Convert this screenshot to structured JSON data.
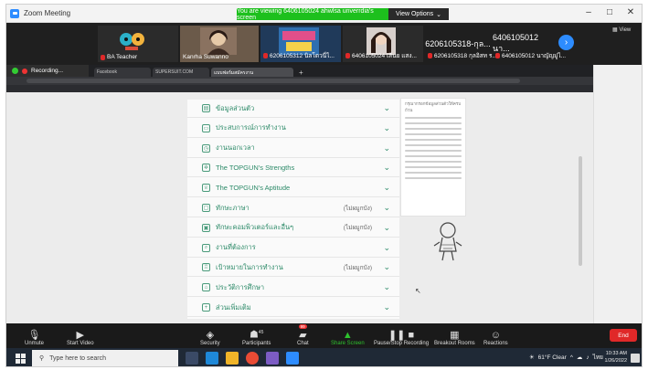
{
  "zoom": {
    "title": "Zoom Meeting",
    "viewing_banner": "You are viewing 6406105024 ahwlsa unverrdia's screen",
    "view_options": "View Options",
    "view_options_caret": "⌄",
    "win_min": "–",
    "win_max": "□",
    "win_close": "✕",
    "view_label": "View"
  },
  "participants_strip": [
    {
      "name": "BA Teacher"
    },
    {
      "name": "Kanrha Suwanno"
    },
    {
      "name": "6206105312 นิลโดวนี่ไ..."
    },
    {
      "name": "6406105024 เส้นย แสง..."
    },
    {
      "name": "6206105318 กุลอิสท ร..."
    },
    {
      "name": "6406105012 นาญัญมู่ไ..."
    }
  ],
  "text_tiles": [
    "6206105318-กุล...",
    "6406105012 นา..."
  ],
  "next_page_glyph": "›",
  "recording": {
    "label": "Recording..."
  },
  "browser_tabs": [
    "Facebook",
    "SUPERSUIT.COM",
    "แบบฟอร์มสมัครงาน",
    "+"
  ],
  "form_sections": [
    {
      "icon": "id-card-icon",
      "glyph": "▤",
      "label": "ข้อมูลส่วนตัว",
      "optional": ""
    },
    {
      "icon": "briefcase-icon",
      "glyph": "▭",
      "label": "ประสบการณ์การทำงาน",
      "optional": ""
    },
    {
      "icon": "clock-icon",
      "glyph": "◷",
      "label": "งานนอกเวลา",
      "optional": ""
    },
    {
      "icon": "gear-icon",
      "glyph": "✲",
      "label": "The TOPGUN's Strengths",
      "optional": ""
    },
    {
      "icon": "trophy-icon",
      "glyph": "♕",
      "label": "The TOPGUN's Aptitude",
      "optional": ""
    },
    {
      "icon": "chat-icon",
      "glyph": "▢",
      "label": "ทักษะภาษา",
      "optional": "(ไม่ผมูกบัง)"
    },
    {
      "icon": "monitor-icon",
      "glyph": "▣",
      "label": "ทักษะคอมพิวเตอร์และอื่นๆ",
      "optional": "(ไม่ผมูกบัง)"
    },
    {
      "icon": "search-icon",
      "glyph": "⌕",
      "label": "งานที่ต้องการ",
      "optional": ""
    },
    {
      "icon": "target-icon",
      "glyph": "♖",
      "label": "เป้าหมายในการทำงาน",
      "optional": "(ไม่ผมูกบัง)"
    },
    {
      "icon": "cap-icon",
      "glyph": "⌂",
      "label": "ประวัติการศึกษา",
      "optional": ""
    },
    {
      "icon": "plus-icon",
      "glyph": "+",
      "label": "ส่วนเพิ่มเติม",
      "optional": ""
    }
  ],
  "chevron": "⌄",
  "hint_text": "กรุณากรอกข้อมูลส่วนตัวให้ครบถ้วน",
  "toolbar": {
    "unmute": "Unmute",
    "start_video": "Start Video",
    "security": "Security",
    "participants": "Participants",
    "participants_count": "45",
    "chat": "Chat",
    "chat_badge": "99",
    "share_screen": "Share Screen",
    "pause_share": "Pause/Stop Recording",
    "breakout": "Breakout Rooms",
    "reactions": "Reactions",
    "end": "End"
  },
  "taskbar": {
    "search_placeholder": "Type here to search",
    "weather": "61°F  Clear",
    "lang": "ไทย",
    "time": "10:33 AM",
    "date": "1/26/2022"
  }
}
